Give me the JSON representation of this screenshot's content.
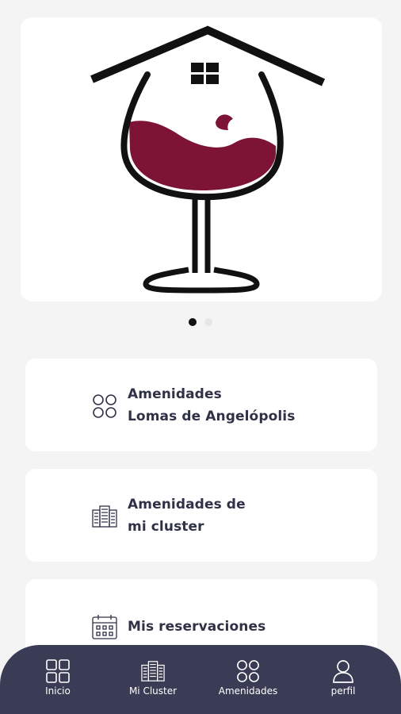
{
  "carousel": {
    "slide_count": 2,
    "active_index": 0
  },
  "menu": [
    {
      "line1": "Amenidades",
      "line2": "Lomas de Angelópolis",
      "icon": "circles-grid-icon"
    },
    {
      "line1": "Amenidades de",
      "line2": "mi cluster",
      "icon": "building-icon"
    },
    {
      "line1": "Mis reservaciones",
      "line2": "",
      "icon": "calendar-icon"
    }
  ],
  "bottom_nav": {
    "items": [
      {
        "label": "Inicio",
        "icon": "grid-icon"
      },
      {
        "label": "Mi Cluster",
        "icon": "building-icon"
      },
      {
        "label": "Amenidades",
        "icon": "circles-grid-icon"
      },
      {
        "label": "perfil",
        "icon": "user-icon"
      }
    ]
  },
  "colors": {
    "background": "#f4f4f5",
    "card": "#ffffff",
    "text": "#2f3147",
    "nav_bar": "#3a3b54",
    "wine": "#7d1435",
    "logo_stroke": "#111111"
  }
}
